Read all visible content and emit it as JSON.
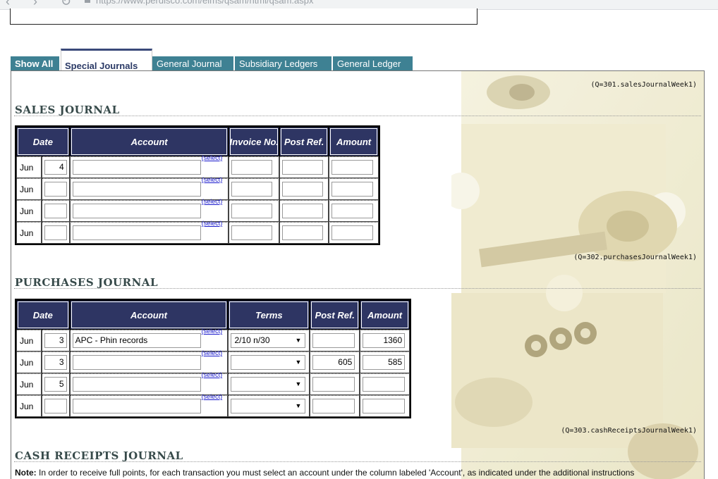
{
  "browser": {
    "url": "https://www.perdisco.com/elms/qsam/html/qsam.aspx"
  },
  "tabs": [
    {
      "label": "Show All"
    },
    {
      "label": "Special Journals"
    },
    {
      "label": "General Journal"
    },
    {
      "label": "Subsidiary Ledgers"
    },
    {
      "label": "General Ledger"
    }
  ],
  "sales": {
    "qref": "(Q=301.salesJournalWeek1)",
    "title": "SALES JOURNAL",
    "headers": {
      "date": "Date",
      "account": "Account",
      "invoice": "Invoice No.",
      "post_ref": "Post Ref.",
      "amount": "Amount"
    },
    "rows": [
      {
        "month": "Jun",
        "day": "4",
        "account": "",
        "invoice": "",
        "post_ref": "",
        "amount": ""
      },
      {
        "month": "Jun",
        "day": "",
        "account": "",
        "invoice": "",
        "post_ref": "",
        "amount": ""
      },
      {
        "month": "Jun",
        "day": "",
        "account": "",
        "invoice": "",
        "post_ref": "",
        "amount": ""
      },
      {
        "month": "Jun",
        "day": "",
        "account": "",
        "invoice": "",
        "post_ref": "",
        "amount": ""
      }
    ]
  },
  "purchases": {
    "qref": "(Q=302.purchasesJournalWeek1)",
    "title": "PURCHASES JOURNAL",
    "headers": {
      "date": "Date",
      "account": "Account",
      "terms": "Terms",
      "post_ref": "Post Ref.",
      "amount": "Amount"
    },
    "rows": [
      {
        "month": "Jun",
        "day": "3",
        "account": "APC - Phin records",
        "terms": "2/10 n/30",
        "post_ref": "",
        "amount": "1360"
      },
      {
        "month": "Jun",
        "day": "3",
        "account": "",
        "terms": "",
        "post_ref": "605",
        "amount": "585"
      },
      {
        "month": "Jun",
        "day": "5",
        "account": "",
        "terms": "",
        "post_ref": "",
        "amount": ""
      },
      {
        "month": "Jun",
        "day": "",
        "account": "",
        "terms": "",
        "post_ref": "",
        "amount": ""
      }
    ]
  },
  "cash_receipts": {
    "qref": "(Q=303.cashReceiptsJournalWeek1)",
    "title": "CASH RECEIPTS JOURNAL",
    "note_label": "Note:",
    "note_text": "In order to receive full points, for each transaction you must select an account under the column labeled 'Account', as indicated under the additional instructions"
  },
  "select_link": "(select)",
  "colors": {
    "tab_bg": "#3e8193",
    "header_bg": "#2e3563",
    "title_color": "#374a4a"
  }
}
